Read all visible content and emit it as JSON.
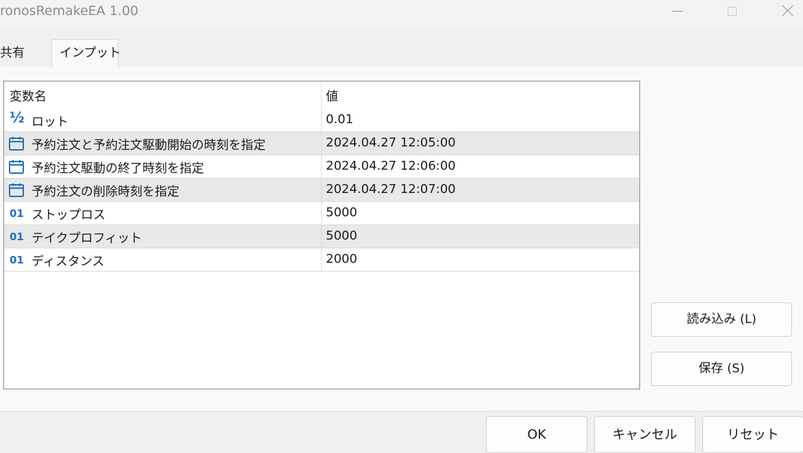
{
  "window": {
    "title": "ronosRemakeEA 1.00"
  },
  "tabs": [
    {
      "label": "共有"
    },
    {
      "label": "インプット"
    }
  ],
  "table": {
    "headers": {
      "name": "変数名",
      "value": "値"
    },
    "rows": [
      {
        "icon": "fraction-icon",
        "icon_glyph": "½",
        "name": "ロット",
        "value": "0.01"
      },
      {
        "icon": "calendar-icon",
        "name": "予約注文と予約注文駆動開始の時刻を指定",
        "value": "2024.04.27 12:05:00"
      },
      {
        "icon": "calendar-icon",
        "name": "予約注文駆動の終了時刻を指定",
        "value": "2024.04.27 12:06:00"
      },
      {
        "icon": "calendar-icon",
        "name": "予約注文の削除時刻を指定",
        "value": "2024.04.27 12:07:00"
      },
      {
        "icon": "integer-icon",
        "icon_glyph": "01",
        "name": "ストップロス",
        "value": "5000"
      },
      {
        "icon": "integer-icon",
        "icon_glyph": "01",
        "name": "テイクプロフィット",
        "value": "5000"
      },
      {
        "icon": "integer-icon",
        "icon_glyph": "01",
        "name": "ディスタンス",
        "value": "2000"
      }
    ]
  },
  "side_buttons": {
    "load": "読み込み (L)",
    "save": "保存 (S)"
  },
  "footer_buttons": {
    "ok": "OK",
    "cancel": "キャンセル",
    "reset": "リセット"
  },
  "colors": {
    "icon_blue": "#1f6fc0",
    "alt_row": "#e8e8e8"
  }
}
